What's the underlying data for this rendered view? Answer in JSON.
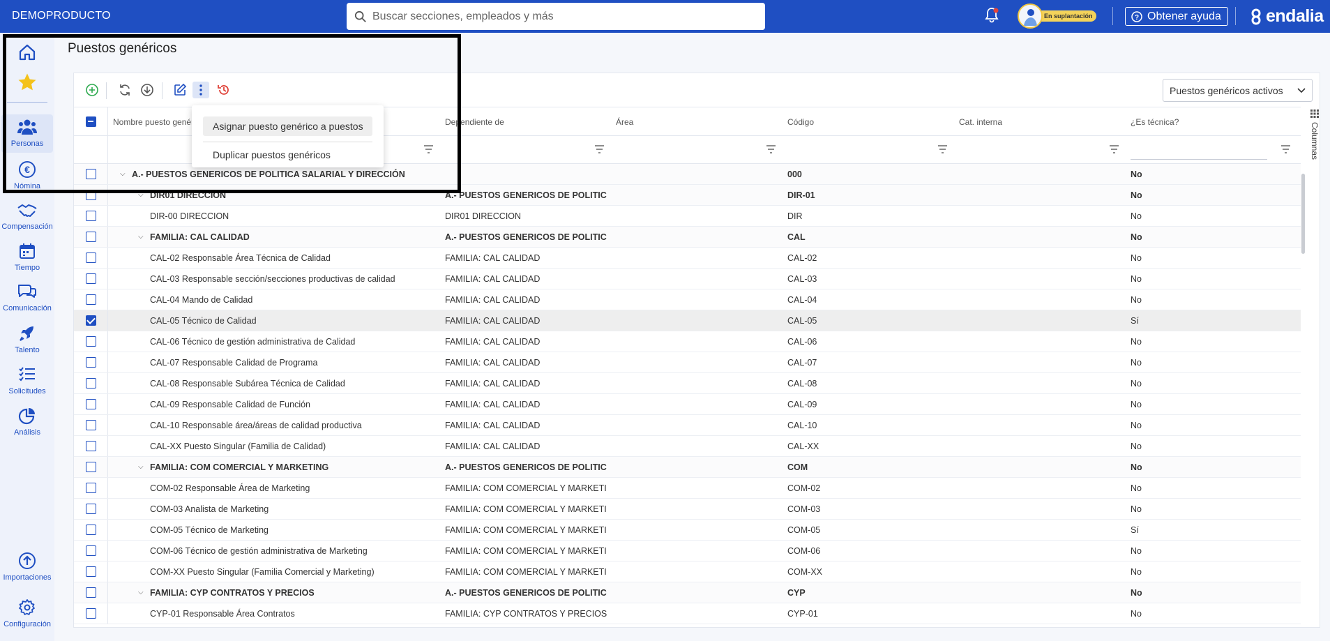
{
  "app": {
    "brand": "DEMOPRODUCTO",
    "search_placeholder": "Buscar secciones, empleados y más",
    "impersonation_badge": "En suplantación",
    "help_label": "Obtener ayuda",
    "logo_text": "endalia"
  },
  "sidebar": {
    "items": [
      {
        "label": "",
        "icon": "home-icon"
      },
      {
        "label": "",
        "icon": "star-icon"
      },
      {
        "label": "Personas",
        "icon": "people-icon"
      },
      {
        "label": "Nómina",
        "icon": "euro-icon"
      },
      {
        "label": "Compensación",
        "icon": "handshake-icon"
      },
      {
        "label": "Tiempo",
        "icon": "calendar-icon"
      },
      {
        "label": "Comunicación",
        "icon": "chat-icon"
      },
      {
        "label": "Talento",
        "icon": "rocket-icon"
      },
      {
        "label": "Solicitudes",
        "icon": "checklist-icon"
      },
      {
        "label": "Análisis",
        "icon": "pie-chart-icon"
      },
      {
        "label": "Importaciones",
        "icon": "upload-icon"
      },
      {
        "label": "Configuración",
        "icon": "gear-icon"
      }
    ]
  },
  "page": {
    "title": "Puestos genéricos",
    "filter_select_value": "Puestos genéricos activos",
    "columns_tab_label": "Columnas"
  },
  "context_menu": {
    "items": [
      "Asignar puesto genérico a puestos",
      "Duplicar puestos genéricos"
    ]
  },
  "table": {
    "headers": [
      "Nombre puesto genérico",
      "Dependiente de",
      "Área",
      "Código",
      "Cat. interna",
      "¿Es técnica?"
    ],
    "rows": [
      {
        "level": 0,
        "group": true,
        "checked": false,
        "name": "A.- PUESTOS GENERICOS DE POLITICA SALARIAL Y DIRECCIÓN",
        "depends": "",
        "area": "",
        "code": "000",
        "cat": "",
        "tech": "No"
      },
      {
        "level": 1,
        "group": true,
        "checked": false,
        "name": "DIR01 DIRECCION",
        "depends": "A.- PUESTOS GENERICOS DE POLITICA SALARIAL Y DIRECCIÓN",
        "area": "",
        "code": "DIR-01",
        "cat": "",
        "tech": "No"
      },
      {
        "level": 2,
        "group": false,
        "checked": false,
        "name": "DIR-00 DIRECCION",
        "depends": "DIR01 DIRECCION",
        "area": "",
        "code": "DIR",
        "cat": "",
        "tech": "No"
      },
      {
        "level": 1,
        "group": true,
        "checked": false,
        "name": "FAMILIA: CAL CALIDAD",
        "depends": "A.- PUESTOS GENERICOS DE POLITICA SALARIAL Y DIRECCIÓN",
        "area": "",
        "code": "CAL",
        "cat": "",
        "tech": "No"
      },
      {
        "level": 2,
        "group": false,
        "checked": false,
        "name": "CAL-02 Responsable Área Técnica de Calidad",
        "depends": "FAMILIA: CAL CALIDAD",
        "area": "",
        "code": "CAL-02",
        "cat": "",
        "tech": "No"
      },
      {
        "level": 2,
        "group": false,
        "checked": false,
        "name": "CAL-03 Responsable sección/secciones productivas de calidad",
        "depends": "FAMILIA: CAL CALIDAD",
        "area": "",
        "code": "CAL-03",
        "cat": "",
        "tech": "No"
      },
      {
        "level": 2,
        "group": false,
        "checked": false,
        "name": "CAL-04 Mando de Calidad",
        "depends": "FAMILIA: CAL CALIDAD",
        "area": "",
        "code": "CAL-04",
        "cat": "",
        "tech": "No"
      },
      {
        "level": 2,
        "group": false,
        "checked": true,
        "name": "CAL-05 Técnico de Calidad",
        "depends": "FAMILIA: CAL CALIDAD",
        "area": "",
        "code": "CAL-05",
        "cat": "",
        "tech": "Sí"
      },
      {
        "level": 2,
        "group": false,
        "checked": false,
        "name": "CAL-06 Técnico de gestión administrativa de Calidad",
        "depends": "FAMILIA: CAL CALIDAD",
        "area": "",
        "code": "CAL-06",
        "cat": "",
        "tech": "No"
      },
      {
        "level": 2,
        "group": false,
        "checked": false,
        "name": "CAL-07 Responsable Calidad de Programa",
        "depends": "FAMILIA: CAL CALIDAD",
        "area": "",
        "code": "CAL-07",
        "cat": "",
        "tech": "No"
      },
      {
        "level": 2,
        "group": false,
        "checked": false,
        "name": "CAL-08 Responsable Subárea Técnica de Calidad",
        "depends": "FAMILIA: CAL CALIDAD",
        "area": "",
        "code": "CAL-08",
        "cat": "",
        "tech": "No"
      },
      {
        "level": 2,
        "group": false,
        "checked": false,
        "name": "CAL-09 Responsable Calidad de Función",
        "depends": "FAMILIA: CAL CALIDAD",
        "area": "",
        "code": "CAL-09",
        "cat": "",
        "tech": "No"
      },
      {
        "level": 2,
        "group": false,
        "checked": false,
        "name": "CAL-10 Responsable área/áreas de calidad productiva",
        "depends": "FAMILIA: CAL CALIDAD",
        "area": "",
        "code": "CAL-10",
        "cat": "",
        "tech": "No"
      },
      {
        "level": 2,
        "group": false,
        "checked": false,
        "name": "CAL-XX Puesto Singular (Familia de Calidad)",
        "depends": "FAMILIA: CAL CALIDAD",
        "area": "",
        "code": "CAL-XX",
        "cat": "",
        "tech": "No"
      },
      {
        "level": 1,
        "group": true,
        "checked": false,
        "name": "FAMILIA: COM COMERCIAL Y MARKETING",
        "depends": "A.- PUESTOS GENERICOS DE POLITICA SALARIAL Y DIRECCIÓN",
        "area": "",
        "code": "COM",
        "cat": "",
        "tech": "No"
      },
      {
        "level": 2,
        "group": false,
        "checked": false,
        "name": "COM-02 Responsable Área de Marketing",
        "depends": "FAMILIA: COM COMERCIAL Y MARKETING",
        "area": "",
        "code": "COM-02",
        "cat": "",
        "tech": "No"
      },
      {
        "level": 2,
        "group": false,
        "checked": false,
        "name": "COM-03 Analista de Marketing",
        "depends": "FAMILIA: COM COMERCIAL Y MARKETING",
        "area": "",
        "code": "COM-03",
        "cat": "",
        "tech": "No"
      },
      {
        "level": 2,
        "group": false,
        "checked": false,
        "name": "COM-05 Técnico de Marketing",
        "depends": "FAMILIA: COM COMERCIAL Y MARKETING",
        "area": "",
        "code": "COM-05",
        "cat": "",
        "tech": "Sí"
      },
      {
        "level": 2,
        "group": false,
        "checked": false,
        "name": "COM-06 Técnico de gestión administrativa de Marketing",
        "depends": "FAMILIA: COM COMERCIAL Y MARKETING",
        "area": "",
        "code": "COM-06",
        "cat": "",
        "tech": "No"
      },
      {
        "level": 2,
        "group": false,
        "checked": false,
        "name": "COM-XX Puesto Singular (Familia Comercial y Marketing)",
        "depends": "FAMILIA: COM COMERCIAL Y MARKETING",
        "area": "",
        "code": "COM-XX",
        "cat": "",
        "tech": "No"
      },
      {
        "level": 1,
        "group": true,
        "checked": false,
        "name": "FAMILIA: CYP CONTRATOS Y PRECIOS",
        "depends": "A.- PUESTOS GENERICOS DE POLITICA SALARIAL Y DIRECCIÓN",
        "area": "",
        "code": "CYP",
        "cat": "",
        "tech": "No"
      },
      {
        "level": 2,
        "group": false,
        "checked": false,
        "name": "CYP-01 Responsable Área Contratos",
        "depends": "FAMILIA: CYP CONTRATOS Y PRECIOS",
        "area": "",
        "code": "CYP-01",
        "cat": "",
        "tech": "No"
      }
    ]
  },
  "colors": {
    "primary": "#1f4fc2",
    "badge": "#f4d35a",
    "add": "#2eaa4f",
    "history": "#e0443b"
  }
}
